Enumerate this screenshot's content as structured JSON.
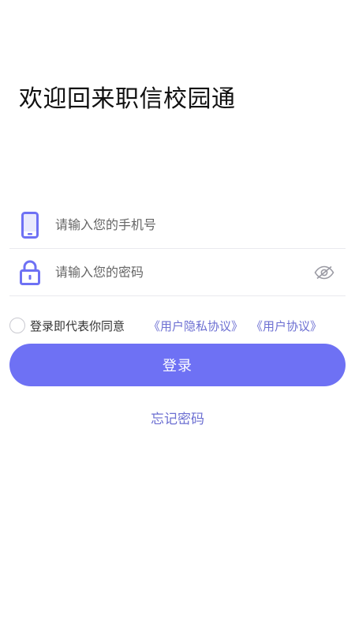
{
  "header": {
    "title": "欢迎回来职信校园通"
  },
  "form": {
    "phone": {
      "placeholder": "请输入您的手机号",
      "value": "",
      "icon": "phone-icon"
    },
    "password": {
      "placeholder": "请输入您的密码",
      "value": "",
      "icon": "lock-icon",
      "toggle_icon": "eye-hidden-icon"
    }
  },
  "agreement": {
    "checked": false,
    "text": "登录即代表你同意",
    "privacy_link": "《用户隐私协议》",
    "user_link": "《用户协议》"
  },
  "actions": {
    "login_label": "登录",
    "forgot_label": "忘记密码"
  },
  "colors": {
    "accent": "#6e71f4",
    "link": "#6c6fd2"
  }
}
